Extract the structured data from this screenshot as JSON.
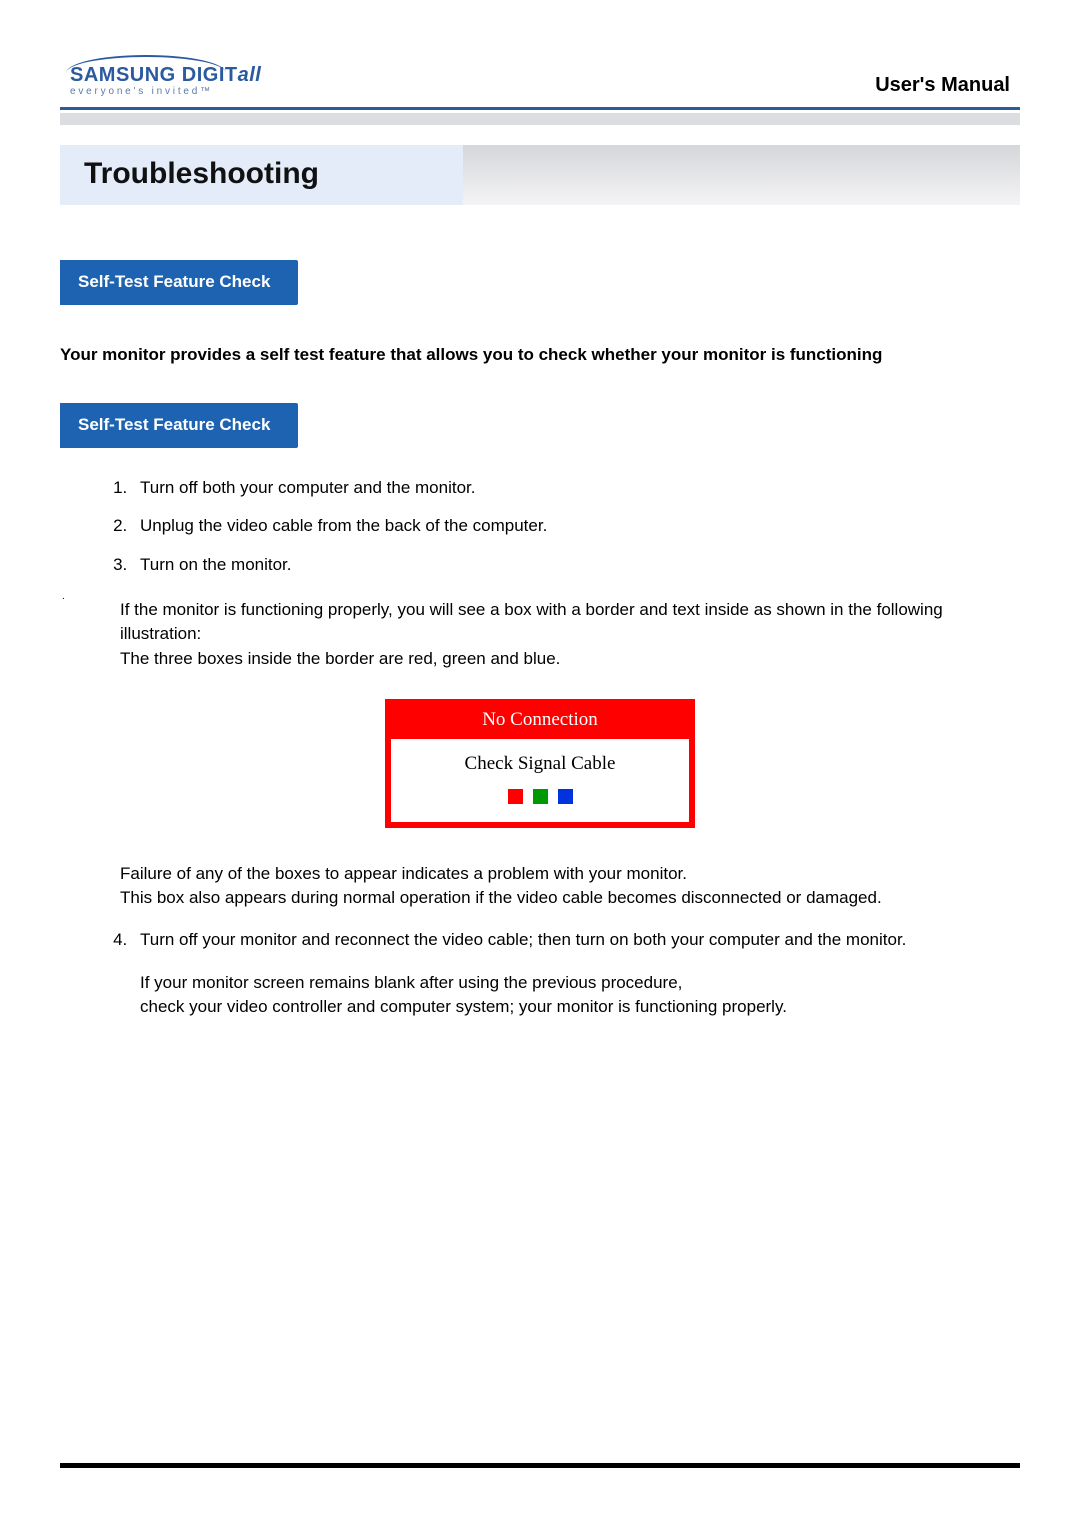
{
  "header": {
    "logo_brand": "SAMSUNG DIGIT",
    "logo_suffix": "all",
    "tagline": "everyone's invited™",
    "right_title": "User's Manual"
  },
  "title": "Troubleshooting",
  "section_pill": "Self-Test Feature Check",
  "intro": "Your monitor provides a self test feature that allows you to check whether your monitor is functioning",
  "subsection_pill": "Self-Test Feature Check",
  "steps": {
    "s1": "Turn off both your computer and the monitor.",
    "s2": "Unplug the video cable from the back of the computer.",
    "s3": "Turn on the monitor."
  },
  "after_list": {
    "p1": "If the monitor is functioning properly, you will see a box with a border and  text inside as shown in the following illustration:",
    "p2": "The three boxes inside the border are red, green and blue."
  },
  "noconn": {
    "title": "No Connection",
    "message": "Check Signal Cable"
  },
  "post_box": {
    "p1": "Failure of any of the boxes to appear indicates a problem with your monitor.",
    "p2": "This box also appears during normal operation if the video cable becomes disconnected or damaged."
  },
  "steps2": {
    "s4": "Turn off your monitor and reconnect the video cable; then turn on both your computer and the monitor.",
    "follow_a": "If your monitor screen remains blank after using the previous procedure,",
    "follow_b": "check your video controller and computer system; your monitor is functioning properly."
  }
}
